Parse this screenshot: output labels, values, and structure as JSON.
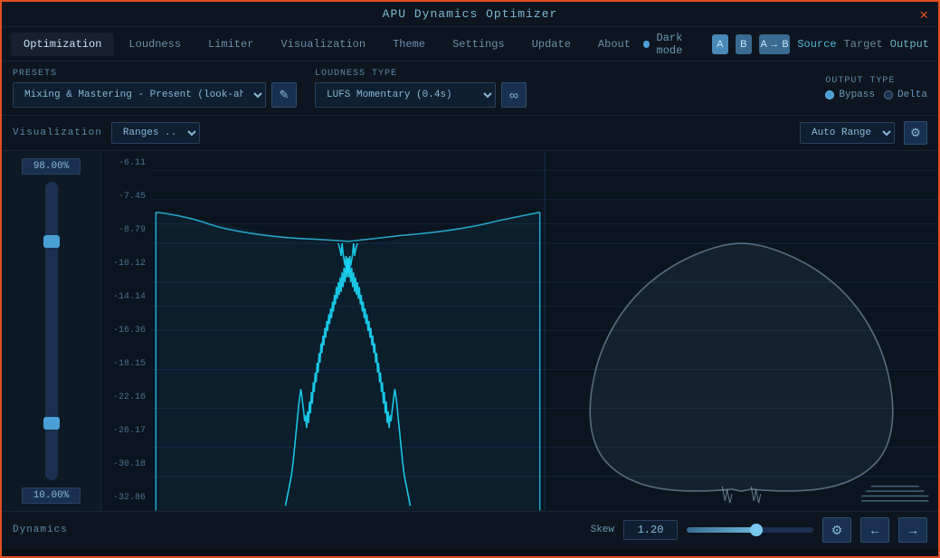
{
  "app": {
    "title": "APU Dynamics Optimizer"
  },
  "nav": {
    "tabs": [
      {
        "id": "optimization",
        "label": "Optimization",
        "active": true
      },
      {
        "id": "loudness",
        "label": "Loudness"
      },
      {
        "id": "limiter",
        "label": "Limiter"
      },
      {
        "id": "visualization",
        "label": "Visualization"
      },
      {
        "id": "theme",
        "label": "Theme"
      },
      {
        "id": "settings",
        "label": "Settings"
      },
      {
        "id": "update",
        "label": "Update"
      },
      {
        "id": "about",
        "label": "About"
      }
    ],
    "dark_mode_label": "Dark mode",
    "ab_buttons": [
      "A",
      "B",
      "A → B"
    ],
    "source_label": "Source",
    "target_label": "Target",
    "output_label": "Output"
  },
  "presets": {
    "label": "Presets",
    "value": "Mixing & Mastering - Present (look-ahead)",
    "edit_icon": "✎"
  },
  "loudness_type": {
    "label": "Loudness type",
    "value": "LUFS Momentary (0.4s)",
    "link_icon": "∞"
  },
  "output_type": {
    "label": "Output type",
    "options": [
      {
        "id": "bypass",
        "label": "Bypass",
        "active": true
      },
      {
        "id": "delta",
        "label": "Delta",
        "active": false
      }
    ]
  },
  "visualization": {
    "label": "Visualization",
    "ranges_label": "Ranges ..",
    "auto_range_label": "Auto Range",
    "settings_icon": "⚙"
  },
  "slider": {
    "top_pct": "98.00%",
    "bottom_pct": "10.00%"
  },
  "y_axis": {
    "labels": [
      "-6.11",
      "-7.45",
      "-8.79",
      "-10.12",
      "-14.14",
      "-16.36",
      "-18.15",
      "-22.16",
      "-26.17",
      "-30.18",
      "-32.86"
    ]
  },
  "dynamics": {
    "label": "Dynamics",
    "skew_label": "Skew",
    "skew_value": "1.20",
    "settings_icon": "⚙",
    "prev_icon": "←",
    "next_icon": "→"
  }
}
